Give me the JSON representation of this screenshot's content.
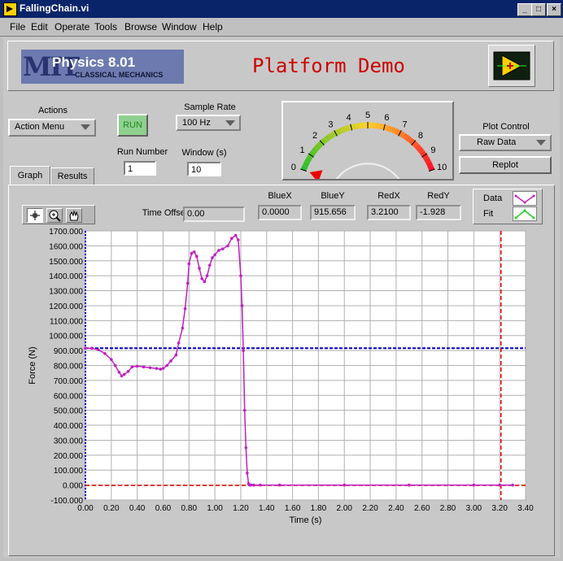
{
  "window": {
    "title": "FallingChain.vi",
    "controls": [
      "_",
      "□",
      "×"
    ]
  },
  "menu": [
    "File",
    "Edit",
    "Operate",
    "Tools",
    "Browse",
    "Window",
    "Help"
  ],
  "header": {
    "logo_mit": "MIT",
    "logo_course": "Physics 8.01",
    "logo_sub": "CLASSICAL MECHANICS",
    "title": "Platform Demo"
  },
  "controls": {
    "actions_label": "Actions",
    "actions_value": "Action Menu",
    "run_label": "RUN",
    "sample_rate_label": "Sample Rate",
    "sample_rate_value": "100 Hz",
    "run_number_label": "Run Number",
    "run_number_value": "1",
    "window_label": "Window (s)",
    "window_value": "10",
    "plot_control_label": "Plot Control",
    "plot_control_value": "Raw Data",
    "replot_label": "Replot"
  },
  "gauge": {
    "ticks": [
      "0",
      "1",
      "2",
      "3",
      "4",
      "5",
      "6",
      "7",
      "8",
      "9",
      "10"
    ],
    "min": 0,
    "max": 10,
    "value": 0
  },
  "tabs": [
    "Graph",
    "Results"
  ],
  "readouts": {
    "time_offset_label": "Time Offset",
    "time_offset": "0.00",
    "bluex_label": "BlueX",
    "bluex": "0.0000",
    "bluey_label": "BlueY",
    "bluey": "915.656",
    "redx_label": "RedX",
    "redx": "3.2100",
    "redy_label": "RedY",
    "redy": "-1.928"
  },
  "legend": [
    {
      "label": "Data",
      "color": "#c020c0"
    },
    {
      "label": "Fit",
      "color": "#20d020"
    }
  ],
  "colors": {
    "data": "#c020c0",
    "blue_cursor": "#0000c0",
    "red_cursor": "#e00000",
    "plot_bg": "#ffffff",
    "grid": "#b0b0b0"
  },
  "chart_data": {
    "type": "line",
    "xlabel": "Time (s)",
    "ylabel": "Force (N)",
    "xlim": [
      0,
      3.4
    ],
    "ylim": [
      -100,
      1700
    ],
    "xticks": [
      "0.00",
      "0.20",
      "0.40",
      "0.60",
      "0.80",
      "1.00",
      "1.20",
      "1.40",
      "1.60",
      "1.80",
      "2.00",
      "2.20",
      "2.40",
      "2.60",
      "2.80",
      "3.00",
      "3.20",
      "3.40"
    ],
    "yticks": [
      "1700.000",
      "1600.000",
      "1500.000",
      "1400.000",
      "1300.000",
      "1200.000",
      "1100.000",
      "1000.000",
      "900.000",
      "800.000",
      "700.000",
      "600.000",
      "500.000",
      "400.000",
      "300.000",
      "200.000",
      "100.000",
      "0.000",
      "-100.000"
    ],
    "blue_cursor": {
      "x": 0.0,
      "y": 915.656
    },
    "red_cursor": {
      "x": 3.21,
      "y": -1.928
    },
    "series": [
      {
        "x": [
          0.0,
          0.05,
          0.1,
          0.15,
          0.2,
          0.23,
          0.26,
          0.28,
          0.3,
          0.33,
          0.36,
          0.4,
          0.45,
          0.5,
          0.55,
          0.58,
          0.6,
          0.63,
          0.66,
          0.7,
          0.72,
          0.75,
          0.77,
          0.79,
          0.8,
          0.82,
          0.84,
          0.86,
          0.88,
          0.9,
          0.92,
          0.94,
          0.96,
          0.98,
          1.0,
          1.03,
          1.06,
          1.1,
          1.13,
          1.16,
          1.18,
          1.2,
          1.21,
          1.22,
          1.23,
          1.24,
          1.25,
          1.26,
          1.27,
          1.28,
          1.3,
          1.35,
          1.5,
          2.0,
          2.5,
          3.0,
          3.2,
          3.3
        ],
        "y": [
          915,
          915,
          905,
          880,
          840,
          800,
          755,
          730,
          740,
          760,
          790,
          795,
          790,
          785,
          780,
          775,
          780,
          800,
          830,
          870,
          950,
          1050,
          1180,
          1350,
          1480,
          1550,
          1560,
          1530,
          1450,
          1380,
          1360,
          1400,
          1470,
          1520,
          1540,
          1570,
          1580,
          1600,
          1650,
          1670,
          1640,
          1400,
          1200,
          900,
          500,
          250,
          80,
          10,
          0,
          0,
          0,
          0,
          0,
          0,
          0,
          0,
          0,
          0
        ]
      }
    ]
  }
}
